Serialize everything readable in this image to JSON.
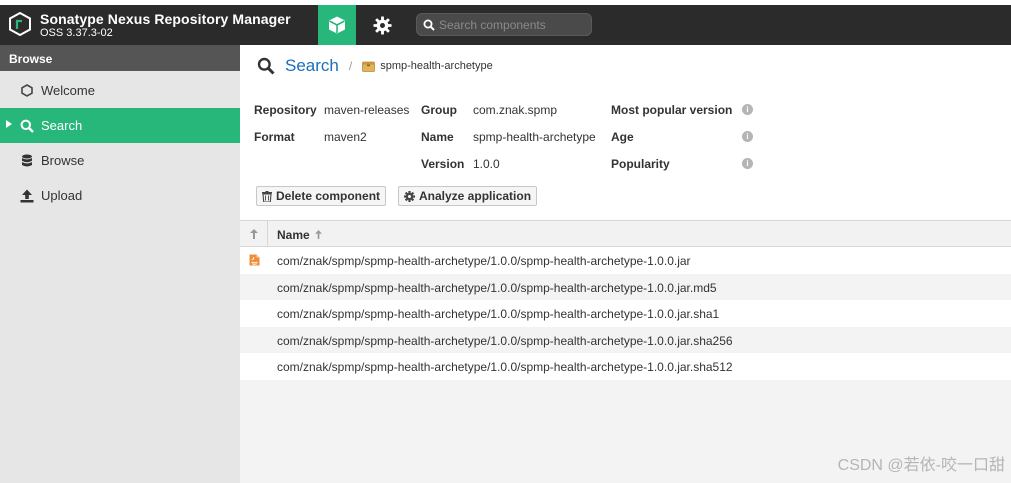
{
  "header": {
    "title": "Sonatype Nexus Repository Manager",
    "version": "OSS 3.37.3-02",
    "search_placeholder": "Search components",
    "browse_icon": "cube-icon",
    "admin_icon": "gear-icon"
  },
  "sidebar": {
    "heading": "Browse",
    "items": [
      {
        "label": "Welcome",
        "icon": "hexagon-icon"
      },
      {
        "label": "Search",
        "icon": "search-icon",
        "active": true
      },
      {
        "label": "Browse",
        "icon": "database-icon"
      },
      {
        "label": "Upload",
        "icon": "upload-icon"
      }
    ]
  },
  "breadcrumb": {
    "root": "Search",
    "separator": "/",
    "leaf": "spmp-health-archetype"
  },
  "component": {
    "repository_label": "Repository",
    "repository_value": "maven-releases",
    "format_label": "Format",
    "format_value": "maven2",
    "group_label": "Group",
    "group_value": "com.znak.spmp",
    "name_label": "Name",
    "name_value": "spmp-health-archetype",
    "version_label": "Version",
    "version_value": "1.0.0",
    "popular_label": "Most popular version",
    "age_label": "Age",
    "popularity_label": "Popularity"
  },
  "toolbar": {
    "delete_label": "Delete component",
    "analyze_label": "Analyze application"
  },
  "grid": {
    "name_header": "Name",
    "rows": [
      "com/znak/spmp/spmp-health-archetype/1.0.0/spmp-health-archetype-1.0.0.jar",
      "com/znak/spmp/spmp-health-archetype/1.0.0/spmp-health-archetype-1.0.0.jar.md5",
      "com/znak/spmp/spmp-health-archetype/1.0.0/spmp-health-archetype-1.0.0.jar.sha1",
      "com/znak/spmp/spmp-health-archetype/1.0.0/spmp-health-archetype-1.0.0.jar.sha256",
      "com/znak/spmp/spmp-health-archetype/1.0.0/spmp-health-archetype-1.0.0.jar.sha512"
    ]
  },
  "watermark": "CSDN @若依-咬一口甜",
  "colors": {
    "accent": "#27b77a",
    "header_bg": "#2b2b2b",
    "link": "#1b6fb8"
  }
}
